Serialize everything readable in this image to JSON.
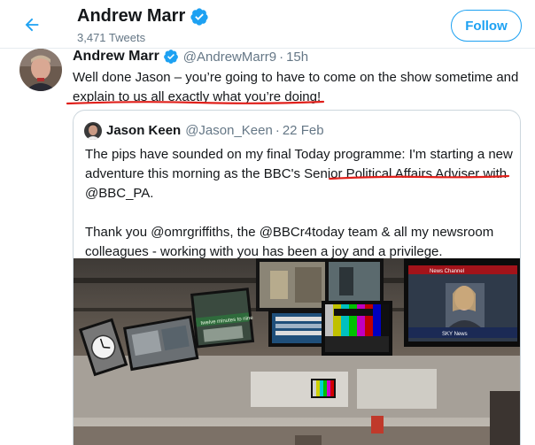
{
  "header": {
    "profile_name": "Andrew Marr",
    "tweet_count": "3,471 Tweets",
    "follow_label": "Follow"
  },
  "tweet": {
    "author_name": "Andrew Marr",
    "handle": "@AndrewMarr9",
    "separator": "·",
    "time": "15h",
    "text": "Well done Jason – you’re going to have to come on the show sometime and explain to us all exactly what you’re doing!"
  },
  "quoted_tweet": {
    "author_name": "Jason Keen",
    "handle": "@Jason_Keen",
    "separator": "·",
    "time": "22 Feb",
    "paragraph_1": "The pips have sounded on my final Today programme: I'm starting a new adventure this morning as the BBC's Senior Political Affairs Adviser with @BBC_PA.",
    "paragraph_2": "Thank you @omrgriffiths, the @BBCr4today team & all my newsroom colleagues - working with you has been a joy and a privilege."
  },
  "photo": {
    "screen_text_1": "twelve minutes to nine",
    "screen_text_2": "News Channel",
    "screen_text_3": "SKY News"
  },
  "colors": {
    "accent": "#1da1f2",
    "annotation_red": "#e0201b",
    "secondary_text": "#657786"
  },
  "icons": {
    "back": "arrow-left-icon",
    "verified": "verified-badge-icon"
  }
}
